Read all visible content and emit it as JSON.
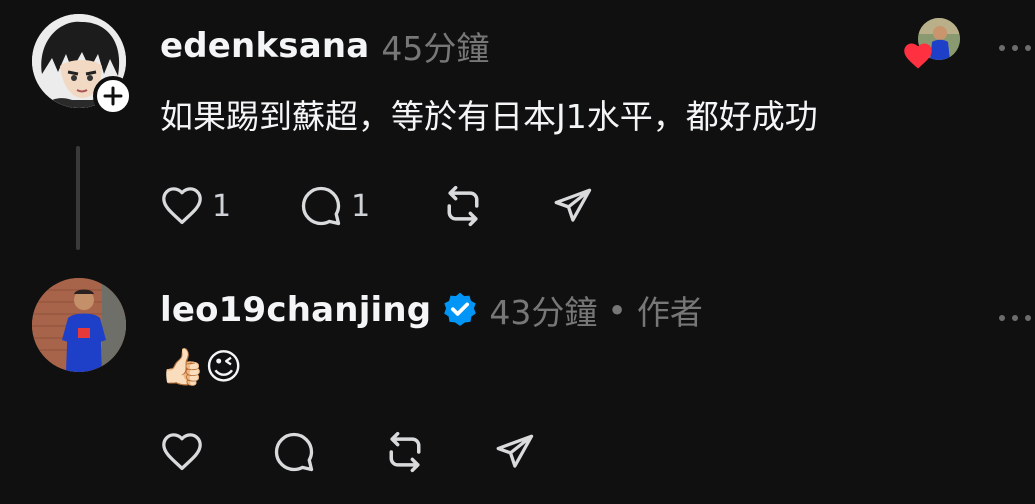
{
  "comments": [
    {
      "username": "edenksana",
      "time": "45分鐘",
      "text": "如果踢到蘇超，等於有日本J1水平，都好成功",
      "likes": "1",
      "replies": "1",
      "liked_by_author": true
    },
    {
      "username": "leo19chanjing",
      "verified": true,
      "time": "43分鐘",
      "author_label": "作者",
      "text": "👍🏻😉"
    }
  ],
  "icons": {
    "like": "heart-icon",
    "reply": "comment-icon",
    "repost": "repost-icon",
    "share": "send-icon",
    "more": "more-icon",
    "follow": "plus-icon",
    "verified": "verified-badge-icon"
  },
  "colors": {
    "background": "#101010",
    "verified": "#0095f6",
    "heart": "#ff3040",
    "meta": "#777777"
  }
}
